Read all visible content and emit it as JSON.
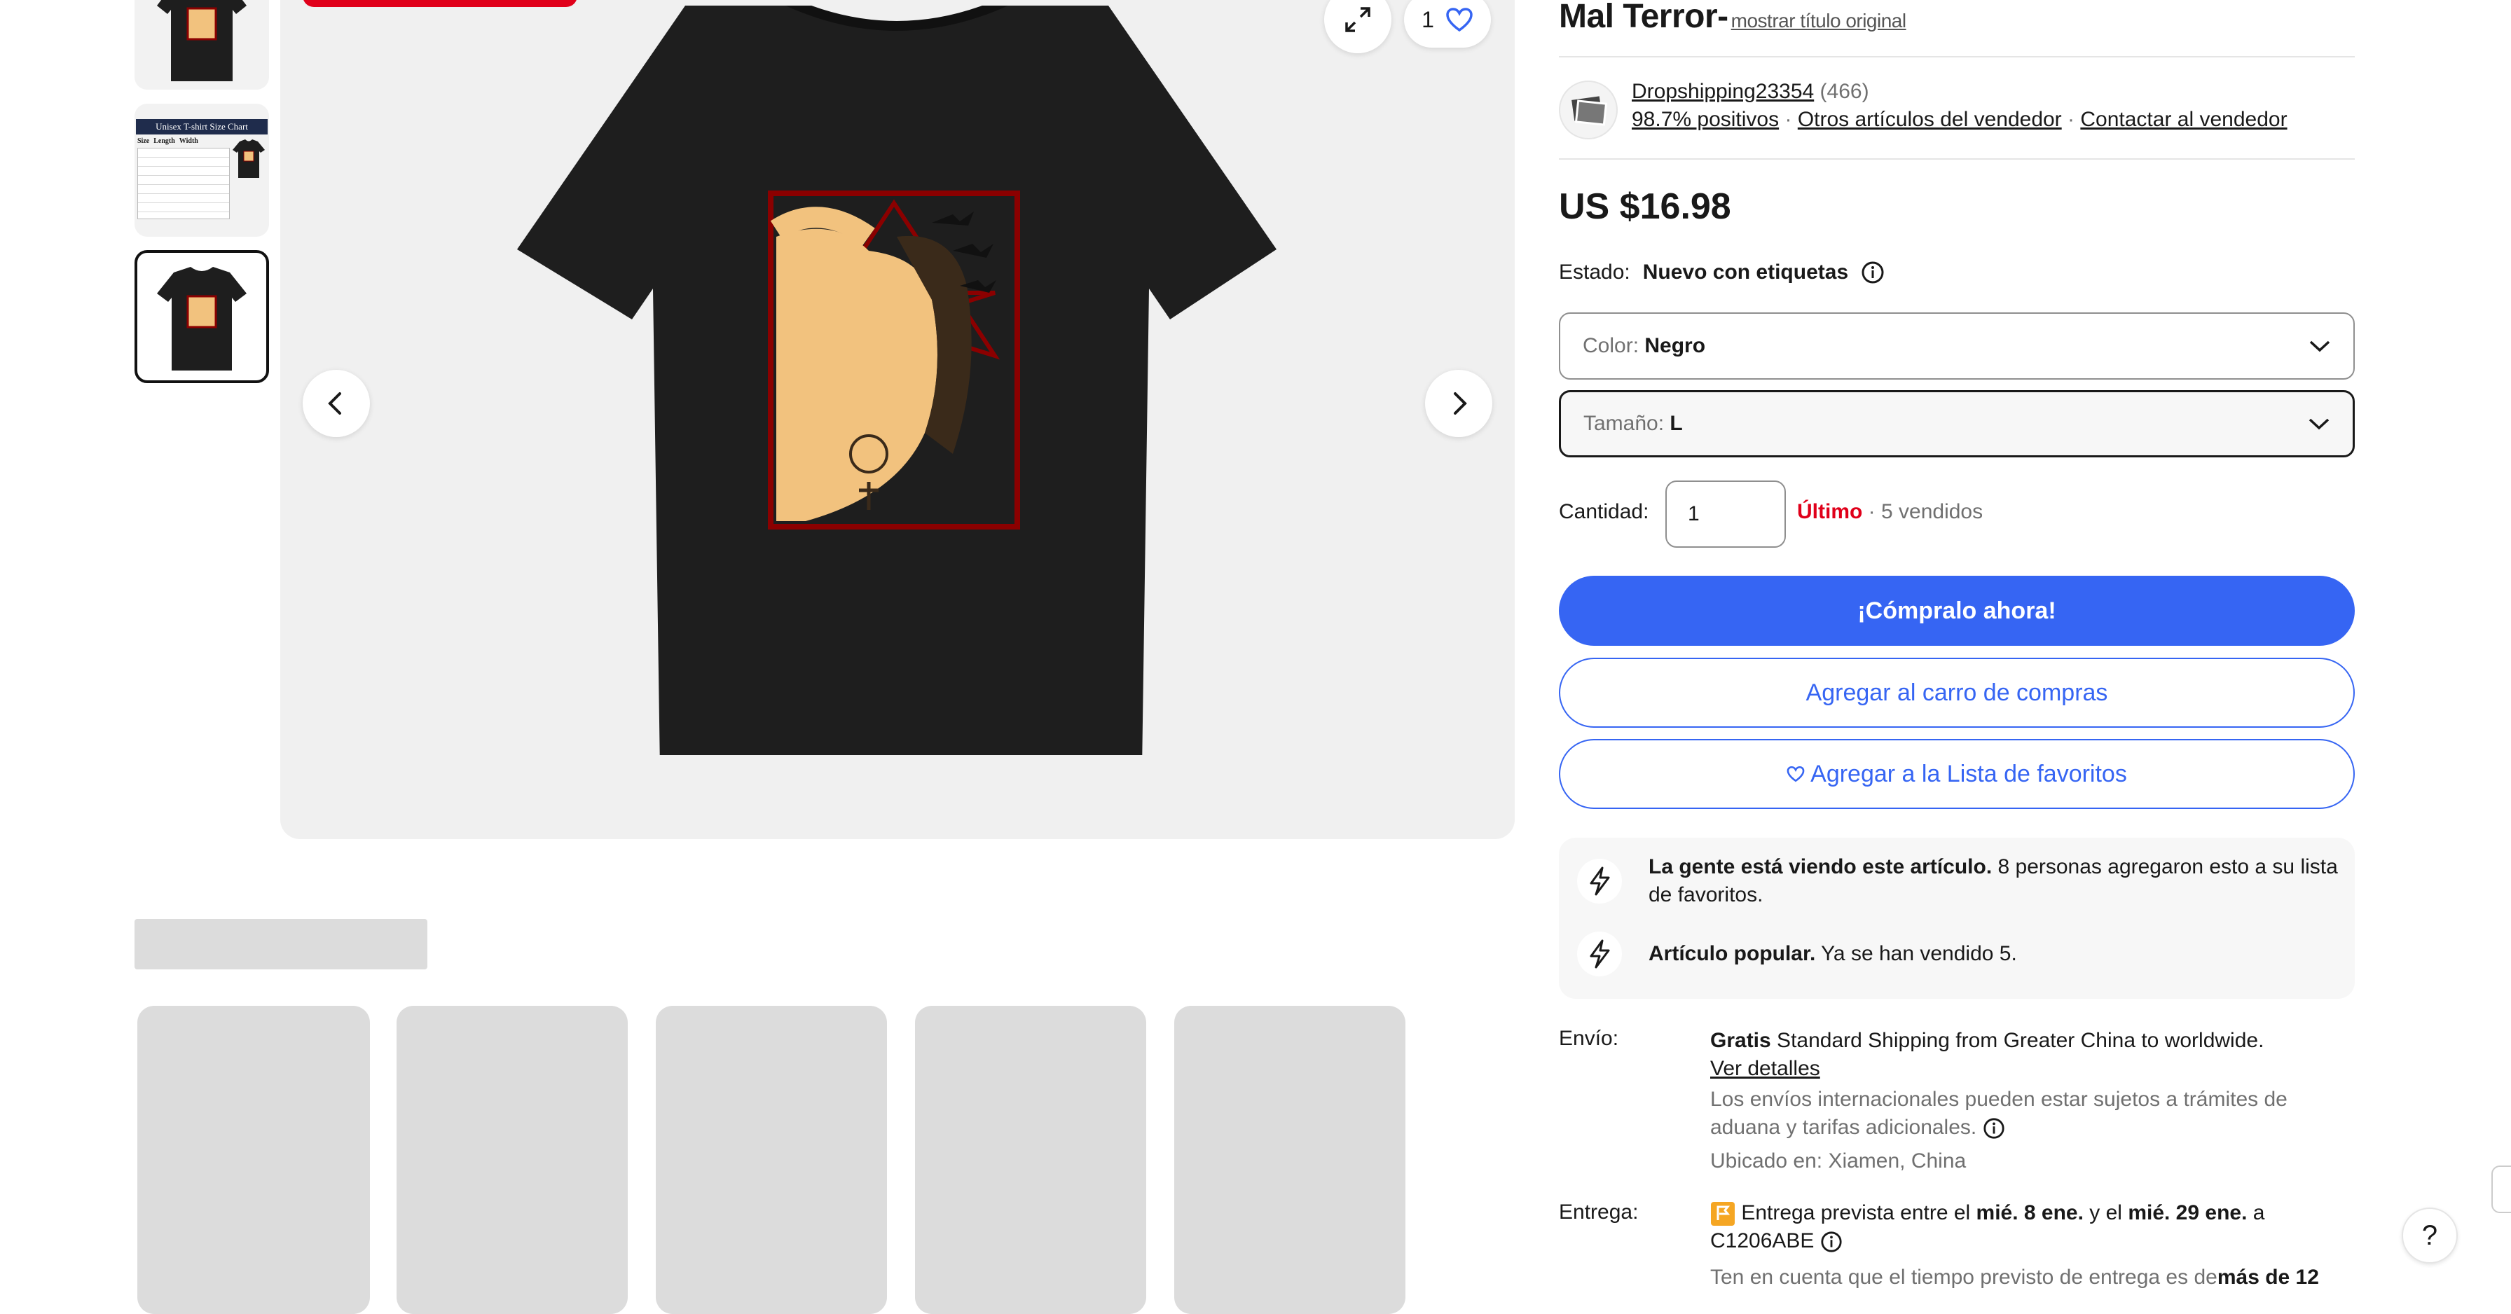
{
  "thumbnails": [
    {
      "name": "shirt-front"
    },
    {
      "name": "size-chart",
      "chart_title": "Unisex T-shirt Size Chart",
      "cols": [
        "Size",
        "Length",
        "Width"
      ]
    },
    {
      "name": "shirt-front-selected"
    }
  ],
  "gallery": {
    "like_count": "1"
  },
  "title": {
    "text": "Mal Terror-",
    "original_link": "mostrar título original"
  },
  "seller": {
    "name": "Dropshipping23354",
    "rating_count": "(466)",
    "positive": "98.7% positivos",
    "other_items": "Otros artículos del vendedor",
    "contact": "Contactar al vendedor",
    "sep": "·"
  },
  "price": "US $16.98",
  "condition": {
    "label": "Estado:",
    "value": "Nuevo con etiquetas"
  },
  "color_select": {
    "label": "Color:",
    "value": "Negro"
  },
  "size_select": {
    "label": "Tamaño:",
    "value": "L"
  },
  "quantity": {
    "label": "Cantidad:",
    "value": "1",
    "last": "Último",
    "sold": "· 5 vendidos"
  },
  "buttons": {
    "buy_now": "¡Cómpralo ahora!",
    "add_cart": "Agregar al carro de compras",
    "add_watch": "Agregar a la Lista de favoritos"
  },
  "signals": [
    {
      "bold": "La gente está viendo este artículo.",
      "text": " 8 personas agregaron esto a su lista de favoritos."
    },
    {
      "bold": "Artículo popular.",
      "text": " Ya se han vendido 5."
    }
  ],
  "shipping": {
    "label": "Envío:",
    "free": "Gratis",
    "service": " Standard Shipping from Greater China to worldwide.",
    "details_link": "Ver detalles",
    "customs": "Los envíos internacionales pueden estar sujetos a trámites de aduana y tarifas adicionales.",
    "location": "Ubicado en: Xiamen, China"
  },
  "delivery": {
    "label": "Entrega:",
    "pre": "Entrega prevista entre el ",
    "date1": "mié. 8 ene.",
    "mid": " y el ",
    "date2": "mié. 29 ene.",
    "post": " a",
    "postal": "C1206ABE",
    "note_pre": "Ten en cuenta que el tiempo previsto de entrega es de",
    "note_bold": "más de 12"
  },
  "help": "?",
  "colors": {
    "accent": "#3665f3",
    "urgent": "#e0001a",
    "muted": "#707070",
    "skeleton": "#dcdcdc",
    "shirt": "#1e1e1e",
    "print_border": "#8b0000",
    "skin": "#f2c27e"
  }
}
